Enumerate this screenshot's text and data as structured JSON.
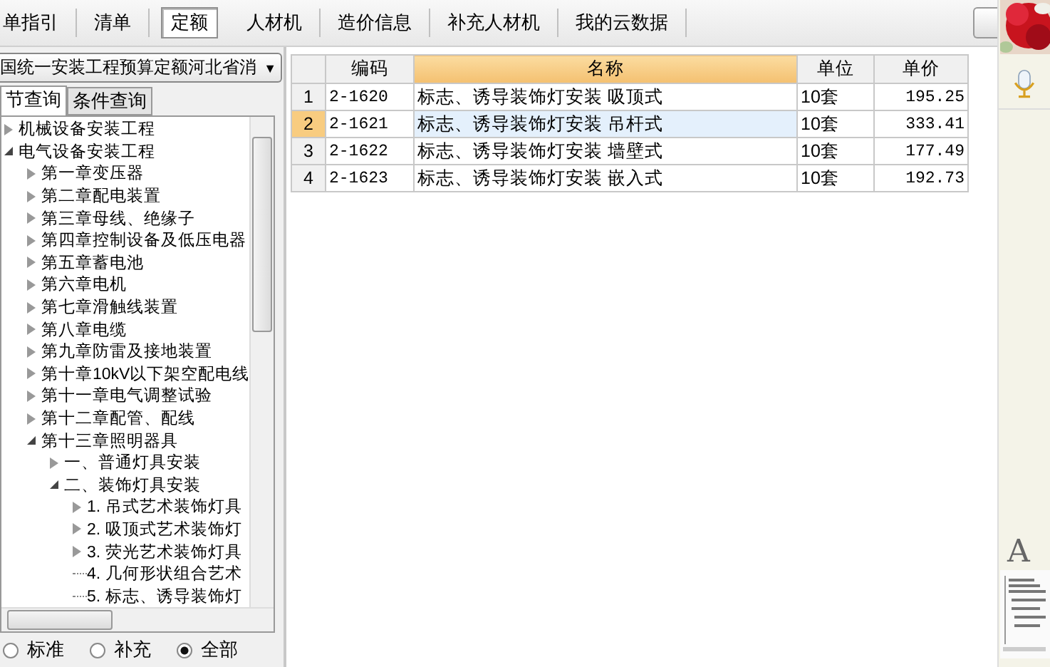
{
  "tabs": [
    {
      "label": "单指引",
      "selected": false
    },
    {
      "label": "清单",
      "selected": false
    },
    {
      "label": "定额",
      "selected": true
    },
    {
      "label": "人材机",
      "selected": false
    },
    {
      "label": "造价信息",
      "selected": false
    },
    {
      "label": "补充人材机",
      "selected": false
    },
    {
      "label": "我的云数据",
      "selected": false
    }
  ],
  "library_dropdown": {
    "value": "国统一安装工程预算定额河北省消",
    "arrow": "▼"
  },
  "query_tabs": [
    {
      "label": "节查询",
      "selected": true
    },
    {
      "label": "条件查询",
      "selected": false
    }
  ],
  "tree": [
    {
      "label": "机械设备安装工程",
      "kind": "branch",
      "expanded": false
    },
    {
      "label": "电气设备安装工程",
      "kind": "branch",
      "expanded": true,
      "children": [
        {
          "label": "第一章变压器",
          "kind": "branch",
          "expanded": false
        },
        {
          "label": "第二章配电装置",
          "kind": "branch",
          "expanded": false
        },
        {
          "label": "第三章母线、绝缘子",
          "kind": "branch",
          "expanded": false
        },
        {
          "label": "第四章控制设备及低压电器",
          "kind": "branch",
          "expanded": false
        },
        {
          "label": "第五章蓄电池",
          "kind": "branch",
          "expanded": false
        },
        {
          "label": "第六章电机",
          "kind": "branch",
          "expanded": false
        },
        {
          "label": "第七章滑触线装置",
          "kind": "branch",
          "expanded": false
        },
        {
          "label": "第八章电缆",
          "kind": "branch",
          "expanded": false
        },
        {
          "label": "第九章防雷及接地装置",
          "kind": "branch",
          "expanded": false
        },
        {
          "label": "第十章10kV以下架空配电线",
          "kind": "branch",
          "expanded": false
        },
        {
          "label": "第十一章电气调整试验",
          "kind": "branch",
          "expanded": false
        },
        {
          "label": "第十二章配管、配线",
          "kind": "branch",
          "expanded": false
        },
        {
          "label": "第十三章照明器具",
          "kind": "branch",
          "expanded": true,
          "children": [
            {
              "label": "一、普通灯具安装",
              "kind": "branch",
              "expanded": false
            },
            {
              "label": "二、装饰灯具安装",
              "kind": "branch",
              "expanded": true,
              "children": [
                {
                  "label": "1. 吊式艺术装饰灯具",
                  "kind": "branch",
                  "expanded": false
                },
                {
                  "label": "2. 吸顶式艺术装饰灯",
                  "kind": "branch",
                  "expanded": false
                },
                {
                  "label": "3. 荧光艺术装饰灯具",
                  "kind": "branch",
                  "expanded": false
                },
                {
                  "label": "4. 几何形状组合艺术",
                  "kind": "leaf"
                },
                {
                  "label": "5. 标志、诱导装饰灯",
                  "kind": "leaf"
                }
              ]
            }
          ]
        }
      ]
    }
  ],
  "filter_options": [
    {
      "label": "标准",
      "selected": false
    },
    {
      "label": "补充",
      "selected": false
    },
    {
      "label": "全部",
      "selected": true
    }
  ],
  "table": {
    "columns": [
      "编码",
      "名称",
      "单位",
      "单价"
    ],
    "rows": [
      {
        "number": "1",
        "code": "2-1620",
        "name": "标志、诱导装饰灯安装 吸顶式",
        "unit": "10套",
        "price": "195.25",
        "selected": false
      },
      {
        "number": "2",
        "code": "2-1621",
        "name": "标志、诱导装饰灯安装 吊杆式",
        "unit": "10套",
        "price": "333.41",
        "selected": true
      },
      {
        "number": "3",
        "code": "2-1622",
        "name": "标志、诱导装饰灯安装 墙壁式",
        "unit": "10套",
        "price": "177.49",
        "selected": false
      },
      {
        "number": "4",
        "code": "2-1623",
        "name": "标志、诱导装饰灯安装 嵌入式",
        "unit": "10套",
        "price": "192.73",
        "selected": false
      }
    ]
  },
  "side_strip": {
    "font_glyph": "A"
  }
}
